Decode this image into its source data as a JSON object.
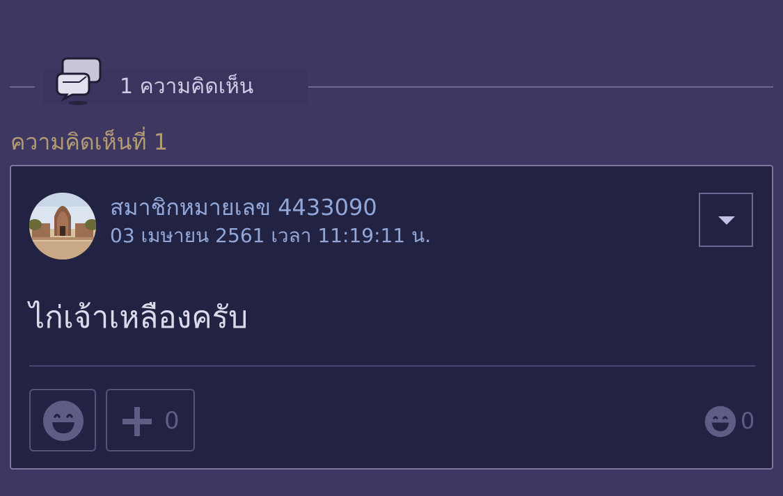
{
  "header": {
    "comment_count_label": "1 ความคิดเห็น",
    "icon": "speech-bubbles-icon"
  },
  "comment": {
    "number_label": "ความคิดเห็นที่ 1",
    "author": "สมาชิกหมายเลข 4433090",
    "timestamp": "03 เมษายน 2561 เวลา 11:19:11 น.",
    "body": "ไก่เจ้าเหลืองครับ",
    "plus_count": "0",
    "reaction_count": "0"
  },
  "colors": {
    "background": "#3d3762",
    "box_background": "#222243",
    "accent_gold": "#b39c72",
    "author_blue": "#93a8d8"
  }
}
